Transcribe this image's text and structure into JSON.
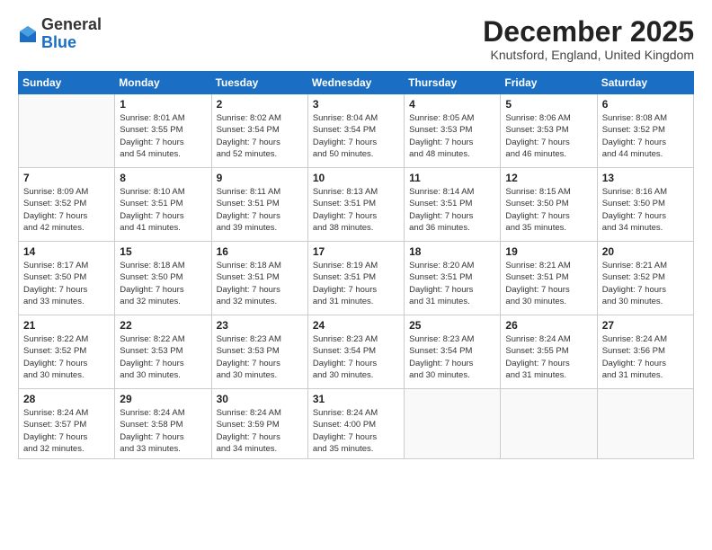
{
  "logo": {
    "general": "General",
    "blue": "Blue"
  },
  "header": {
    "month_year": "December 2025",
    "location": "Knutsford, England, United Kingdom"
  },
  "days_of_week": [
    "Sunday",
    "Monday",
    "Tuesday",
    "Wednesday",
    "Thursday",
    "Friday",
    "Saturday"
  ],
  "weeks": [
    [
      {
        "day": "",
        "info": ""
      },
      {
        "day": "1",
        "info": "Sunrise: 8:01 AM\nSunset: 3:55 PM\nDaylight: 7 hours\nand 54 minutes."
      },
      {
        "day": "2",
        "info": "Sunrise: 8:02 AM\nSunset: 3:54 PM\nDaylight: 7 hours\nand 52 minutes."
      },
      {
        "day": "3",
        "info": "Sunrise: 8:04 AM\nSunset: 3:54 PM\nDaylight: 7 hours\nand 50 minutes."
      },
      {
        "day": "4",
        "info": "Sunrise: 8:05 AM\nSunset: 3:53 PM\nDaylight: 7 hours\nand 48 minutes."
      },
      {
        "day": "5",
        "info": "Sunrise: 8:06 AM\nSunset: 3:53 PM\nDaylight: 7 hours\nand 46 minutes."
      },
      {
        "day": "6",
        "info": "Sunrise: 8:08 AM\nSunset: 3:52 PM\nDaylight: 7 hours\nand 44 minutes."
      }
    ],
    [
      {
        "day": "7",
        "info": "Sunrise: 8:09 AM\nSunset: 3:52 PM\nDaylight: 7 hours\nand 42 minutes."
      },
      {
        "day": "8",
        "info": "Sunrise: 8:10 AM\nSunset: 3:51 PM\nDaylight: 7 hours\nand 41 minutes."
      },
      {
        "day": "9",
        "info": "Sunrise: 8:11 AM\nSunset: 3:51 PM\nDaylight: 7 hours\nand 39 minutes."
      },
      {
        "day": "10",
        "info": "Sunrise: 8:13 AM\nSunset: 3:51 PM\nDaylight: 7 hours\nand 38 minutes."
      },
      {
        "day": "11",
        "info": "Sunrise: 8:14 AM\nSunset: 3:51 PM\nDaylight: 7 hours\nand 36 minutes."
      },
      {
        "day": "12",
        "info": "Sunrise: 8:15 AM\nSunset: 3:50 PM\nDaylight: 7 hours\nand 35 minutes."
      },
      {
        "day": "13",
        "info": "Sunrise: 8:16 AM\nSunset: 3:50 PM\nDaylight: 7 hours\nand 34 minutes."
      }
    ],
    [
      {
        "day": "14",
        "info": "Sunrise: 8:17 AM\nSunset: 3:50 PM\nDaylight: 7 hours\nand 33 minutes."
      },
      {
        "day": "15",
        "info": "Sunrise: 8:18 AM\nSunset: 3:50 PM\nDaylight: 7 hours\nand 32 minutes."
      },
      {
        "day": "16",
        "info": "Sunrise: 8:18 AM\nSunset: 3:51 PM\nDaylight: 7 hours\nand 32 minutes."
      },
      {
        "day": "17",
        "info": "Sunrise: 8:19 AM\nSunset: 3:51 PM\nDaylight: 7 hours\nand 31 minutes."
      },
      {
        "day": "18",
        "info": "Sunrise: 8:20 AM\nSunset: 3:51 PM\nDaylight: 7 hours\nand 31 minutes."
      },
      {
        "day": "19",
        "info": "Sunrise: 8:21 AM\nSunset: 3:51 PM\nDaylight: 7 hours\nand 30 minutes."
      },
      {
        "day": "20",
        "info": "Sunrise: 8:21 AM\nSunset: 3:52 PM\nDaylight: 7 hours\nand 30 minutes."
      }
    ],
    [
      {
        "day": "21",
        "info": "Sunrise: 8:22 AM\nSunset: 3:52 PM\nDaylight: 7 hours\nand 30 minutes."
      },
      {
        "day": "22",
        "info": "Sunrise: 8:22 AM\nSunset: 3:53 PM\nDaylight: 7 hours\nand 30 minutes."
      },
      {
        "day": "23",
        "info": "Sunrise: 8:23 AM\nSunset: 3:53 PM\nDaylight: 7 hours\nand 30 minutes."
      },
      {
        "day": "24",
        "info": "Sunrise: 8:23 AM\nSunset: 3:54 PM\nDaylight: 7 hours\nand 30 minutes."
      },
      {
        "day": "25",
        "info": "Sunrise: 8:23 AM\nSunset: 3:54 PM\nDaylight: 7 hours\nand 30 minutes."
      },
      {
        "day": "26",
        "info": "Sunrise: 8:24 AM\nSunset: 3:55 PM\nDaylight: 7 hours\nand 31 minutes."
      },
      {
        "day": "27",
        "info": "Sunrise: 8:24 AM\nSunset: 3:56 PM\nDaylight: 7 hours\nand 31 minutes."
      }
    ],
    [
      {
        "day": "28",
        "info": "Sunrise: 8:24 AM\nSunset: 3:57 PM\nDaylight: 7 hours\nand 32 minutes."
      },
      {
        "day": "29",
        "info": "Sunrise: 8:24 AM\nSunset: 3:58 PM\nDaylight: 7 hours\nand 33 minutes."
      },
      {
        "day": "30",
        "info": "Sunrise: 8:24 AM\nSunset: 3:59 PM\nDaylight: 7 hours\nand 34 minutes."
      },
      {
        "day": "31",
        "info": "Sunrise: 8:24 AM\nSunset: 4:00 PM\nDaylight: 7 hours\nand 35 minutes."
      },
      {
        "day": "",
        "info": ""
      },
      {
        "day": "",
        "info": ""
      },
      {
        "day": "",
        "info": ""
      }
    ]
  ]
}
